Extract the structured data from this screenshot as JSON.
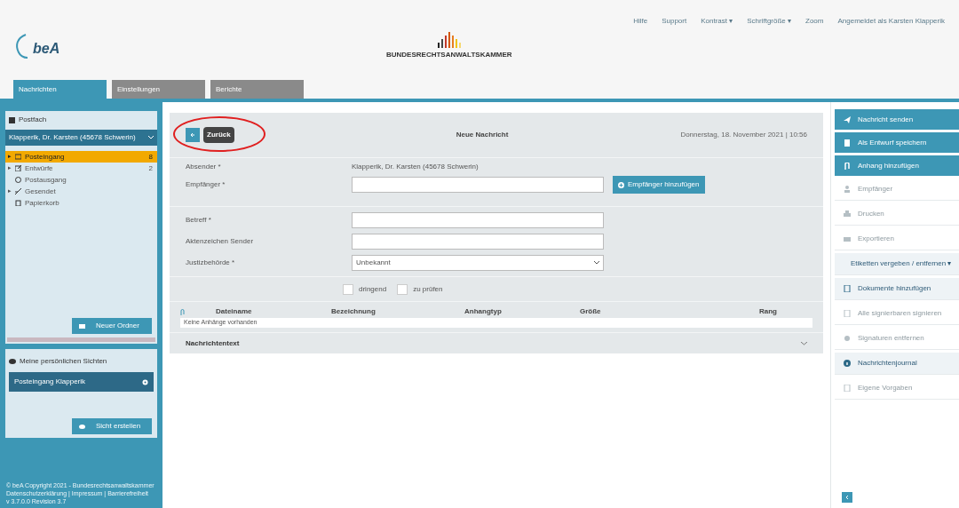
{
  "top_links": [
    {
      "label": "Hilfe"
    },
    {
      "label": "Support"
    },
    {
      "label": "Kontrast ▾"
    },
    {
      "label": "Schriftgröße ▾"
    },
    {
      "label": "Zoom"
    },
    {
      "label": "Angemeldet als Karsten Klapperik"
    }
  ],
  "logo": {
    "text": "beA"
  },
  "brand": {
    "text": "BUNDESRECHTSANWALTSKAMMER"
  },
  "tabs": [
    {
      "label": "Nachrichten",
      "selected": true
    },
    {
      "label": "Einstellungen",
      "selected": false
    },
    {
      "label": "Berichte",
      "selected": false
    }
  ],
  "sidebar": {
    "title": "Postfach",
    "mailbox": "Klapperik, Dr. Karsten (45678 Schwerin)",
    "folders": [
      {
        "kind": "inbox",
        "toggle": "▸",
        "label": "Posteingang",
        "count": "8",
        "selected": true
      },
      {
        "kind": "drafts",
        "toggle": "▸",
        "label": "Entwürfe",
        "count": "2",
        "selected": false
      },
      {
        "kind": "outbox",
        "label": "Postausgang",
        "selected": false
      },
      {
        "kind": "sent",
        "toggle": "▸",
        "label": "Gesendet",
        "selected": false
      },
      {
        "kind": "trash",
        "label": "Papierkorb",
        "selected": false
      }
    ],
    "new_folder": "Neuer Ordner",
    "views_title": "Meine persönlichen Sichten",
    "views": [
      {
        "label": "Posteingang Klapperik"
      }
    ],
    "new_view": "Sicht erstellen",
    "footer": [
      "© beA Copyright 2021 - Bundesrechtsanwaltskammer",
      "Datenschutzerklärung | Impressum | Barrierefreiheit",
      "v 3.7.0.0 Revision 3.7"
    ]
  },
  "message": {
    "back_tooltip": "Zurück",
    "title": "Neue Nachricht",
    "date": "Donnerstag, 18. November 2021 | 10:56",
    "sender_label": "Absender *",
    "sender": "Klapperik, Dr. Karsten (45678 Schwerin)",
    "recipient_label": "Empfänger *",
    "add_recipient": "Empfänger hinzufügen",
    "fields": [
      {
        "kind": "text",
        "label": "Betreff *"
      },
      {
        "kind": "text",
        "label": "Aktenzeichen Sender"
      },
      {
        "kind": "select",
        "label": "Justizbehörde *",
        "value": "Unbekannt"
      }
    ],
    "flags": [
      {
        "label": "dringend",
        "checked": false
      },
      {
        "label": "zu prüfen",
        "checked": false
      }
    ],
    "columns": [
      "Dateiname",
      "Bezeichnung",
      "Anhangtyp",
      "Größe",
      "Rang"
    ],
    "empty": "Keine Anhänge vorhanden",
    "body_section": {
      "label": "Nachrichtentext",
      "expanded": false
    }
  },
  "actions": [
    {
      "kind": "primary",
      "label": "Nachricht senden",
      "disabled": false
    },
    {
      "kind": "primary",
      "label": "Als Entwurf speichern",
      "disabled": false
    },
    {
      "kind": "primary",
      "label": "Anhang hinzufügen",
      "disabled": false
    },
    {
      "kind": "plain",
      "label": "Empfänger",
      "disabled": true
    },
    {
      "kind": "plain",
      "label": "Drucken",
      "disabled": true
    },
    {
      "kind": "plain",
      "label": "Exportieren",
      "disabled": true
    },
    {
      "kind": "plain",
      "label": "Etiketten vergeben / entfernen ▾",
      "disabled": false
    },
    {
      "kind": "plain",
      "label": "Dokumente hinzufügen",
      "disabled": false
    },
    {
      "kind": "plain",
      "label": "Alle signierbaren signieren",
      "disabled": true
    },
    {
      "kind": "plain",
      "label": "Signaturen entfernen",
      "disabled": true
    },
    {
      "kind": "plain",
      "label": "Nachrichtenjournal",
      "disabled": false
    },
    {
      "kind": "plain",
      "label": "Eigene Vorgaben",
      "disabled": true
    }
  ]
}
